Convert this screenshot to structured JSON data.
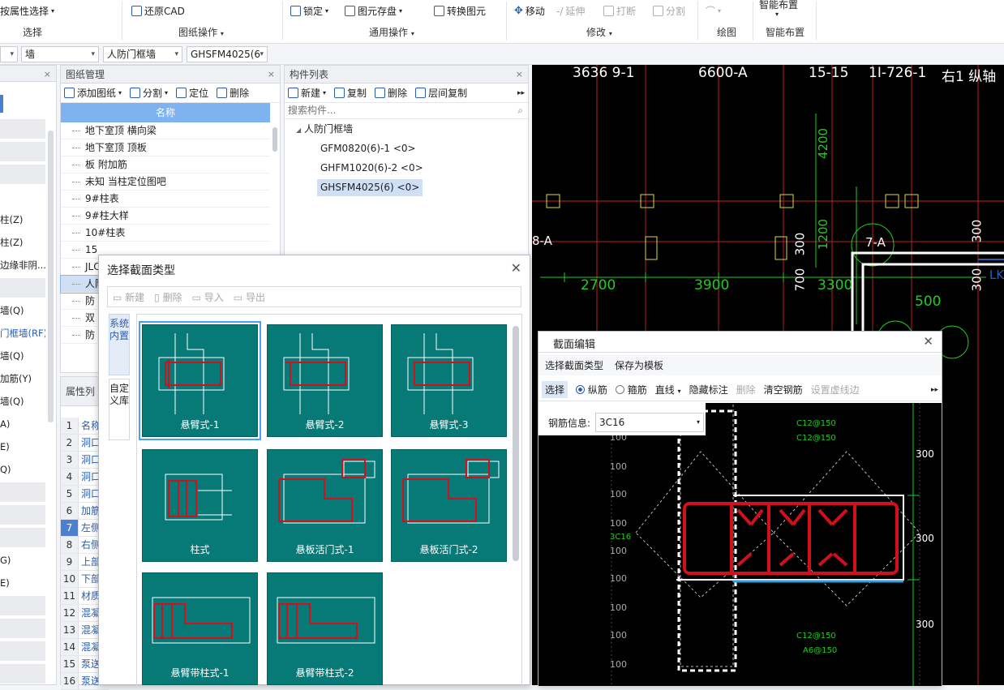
{
  "ribbon": {
    "buttons": {
      "attr_select": "按属性选择",
      "restore_cad": "还原CAD",
      "lock": "锁定",
      "store_elem": "图元存盘",
      "convert_elem": "转换图元",
      "move": "移动",
      "extend": "延伸",
      "break": "打断",
      "split": "分割",
      "smart_layout_top": "智能布置"
    },
    "groups": {
      "select": "选择",
      "drawing_ops": "图纸操作",
      "common_ops": "通用操作",
      "modify": "修改",
      "draw": "绘图",
      "smart_layout": "智能布置"
    }
  },
  "selectors": {
    "s1": "",
    "s2": "墙",
    "s3": "人防门框墙",
    "s4": "GHSFM4025(6"
  },
  "left_strip": {
    "items": [
      "柱(Z)",
      "柱(Z)",
      "边缘非阴...",
      "墙(Q)",
      "门框墙(RF)",
      "墙(Q)",
      "加筋(Y)",
      "墙(Q)",
      "A)",
      "E)",
      "Q)",
      "G)",
      "E)"
    ]
  },
  "drawing_panel": {
    "title": "图纸管理",
    "toolbar": {
      "add": "添加图纸",
      "split": "分割",
      "locate": "定位",
      "delete": "删除"
    },
    "header": "名称",
    "rows": [
      "地下室顶  横向梁",
      "地下室顶  顶板",
      "板  附加筋",
      "未知  当柱定位图吧",
      "9#柱表",
      "9#柱大样",
      "10#柱表",
      "15",
      "JLC",
      "人防",
      "防",
      "双",
      "防"
    ]
  },
  "props_panel": {
    "title": "属性列",
    "rows": [
      {
        "n": "1",
        "t": "名称"
      },
      {
        "n": "2",
        "t": "洞口"
      },
      {
        "n": "3",
        "t": "洞口"
      },
      {
        "n": "4",
        "t": "洞口"
      },
      {
        "n": "5",
        "t": "洞口"
      },
      {
        "n": "6",
        "t": "加筋"
      },
      {
        "n": "7",
        "t": "左侧"
      },
      {
        "n": "8",
        "t": "右侧"
      },
      {
        "n": "9",
        "t": "上部"
      },
      {
        "n": "10",
        "t": "下部"
      },
      {
        "n": "11",
        "t": "材质"
      },
      {
        "n": "12",
        "t": "混凝"
      },
      {
        "n": "13",
        "t": "混凝"
      },
      {
        "n": "14",
        "t": "混凝"
      },
      {
        "n": "15",
        "t": "泵送"
      },
      {
        "n": "16",
        "t": "泵送"
      }
    ]
  },
  "component_panel": {
    "title": "构件列表",
    "toolbar": {
      "new": "新建",
      "copy": "复制",
      "delete": "删除",
      "floor_copy": "层间复制"
    },
    "search_placeholder": "搜索构件...",
    "tree_root": "人防门框墙",
    "items": [
      "GFM0820(6)-1 <0>",
      "GHFM1020(6)-2 <0>",
      "GHSFM4025(6) <0>"
    ]
  },
  "cad": {
    "labels": [
      "3636 9-1",
      "6600-A",
      "15-15",
      "1I-726-1",
      "右1 纵轴",
      "4200",
      "1200",
      "300",
      "7-A",
      "300",
      "300",
      "700",
      "3300",
      "2700",
      "3900",
      "500",
      "8-A",
      "LK"
    ]
  },
  "section_type_dialog": {
    "title": "选择截面类型",
    "toolbar": {
      "new": "新建",
      "delete": "删除",
      "import": "导入",
      "export": "导出"
    },
    "tabs": [
      "系统内置",
      "自定义库"
    ],
    "cards": [
      "悬臂式-1",
      "悬臂式-2",
      "悬臂式-3",
      "柱式",
      "悬板活门式-1",
      "悬板活门式-2",
      "悬臂带柱式-1",
      "悬臂带柱式-2"
    ]
  },
  "section_edit_dialog": {
    "title": "截面编辑",
    "menu": {
      "select_type": "选择截面类型",
      "save_template": "保存为模板"
    },
    "toolbar": {
      "select": "选择",
      "longitudinal": "纵筋",
      "stirrup": "箍筋",
      "line": "直线",
      "hide_marks": "隐藏标注",
      "delete": "删除",
      "clear_rebar": "清空钢筋",
      "set_dashline": "设置虚线边"
    },
    "rebar_label": "钢筋信息:",
    "rebar_value": "3C16",
    "canvas_labels": {
      "left_ticks": [
        "100",
        "100",
        "100",
        "100",
        "100",
        "100",
        "100",
        "100",
        "100",
        "100"
      ],
      "right_dims": [
        "300",
        "300",
        "300"
      ],
      "c1": "C12@150",
      "c2": "C12@150",
      "c3": "C12@150",
      "c4": "A6@150",
      "c5": "3C16"
    }
  },
  "colors": {
    "accent": "#2a5db0",
    "teal": "#077a78",
    "rebar": "#d0101a"
  }
}
